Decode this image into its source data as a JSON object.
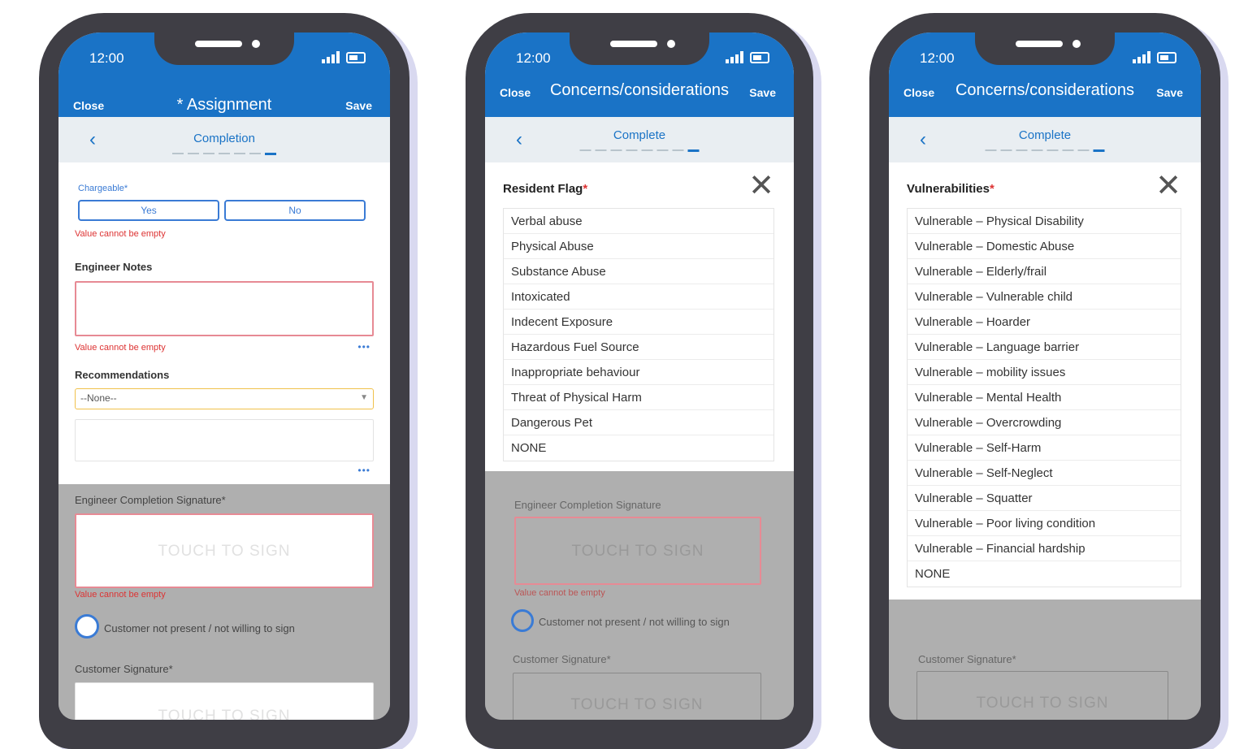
{
  "status": {
    "time": "12:00"
  },
  "phone1": {
    "close": "Close",
    "title": "* Assignment",
    "save": "Save",
    "step": "Completion",
    "chargeable_label": "Chargeable*",
    "yes": "Yes",
    "no": "No",
    "error": "Value cannot be empty",
    "engineer_notes": "Engineer Notes",
    "recommendations": "Recommendations",
    "recommendation_value": "--None--",
    "more": "•••",
    "engineer_signature": "Engineer Completion Signature*",
    "touch_to_sign": "TOUCH TO SIGN",
    "customer_not_present": "Customer not present / not willing to sign",
    "customer_signature": "Customer Signature*"
  },
  "phone2": {
    "close": "Close",
    "title": "Concerns/considerations",
    "save": "Save",
    "step": "Complete",
    "modal_title": "Resident Flag",
    "required_mark": "*",
    "items": [
      "Verbal abuse",
      "Physical Abuse",
      "Substance Abuse",
      "Intoxicated",
      "Indecent Exposure",
      "Hazardous Fuel Source",
      "Inappropriate behaviour",
      "Threat of Physical Harm",
      "Dangerous Pet",
      "NONE"
    ],
    "bg_signature": "Engineer Completion Signature",
    "touch_to_sign": "TOUCH TO SIGN",
    "error": "Value cannot be empty",
    "customer_not_present": "Customer not present / not willing to sign",
    "customer_signature": "Customer Signature*"
  },
  "phone3": {
    "close": "Close",
    "title": "Concerns/considerations",
    "save": "Save",
    "step": "Complete",
    "modal_title": "Vulnerabilities",
    "required_mark": "*",
    "items": [
      "Vulnerable – Physical Disability",
      "Vulnerable – Domestic Abuse",
      "Vulnerable – Elderly/frail",
      "Vulnerable – Vulnerable child",
      "Vulnerable – Hoarder",
      "Vulnerable – Language barrier",
      "Vulnerable – mobility issues",
      "Vulnerable – Mental Health",
      "Vulnerable – Overcrowding",
      "Vulnerable – Self-Harm",
      "Vulnerable – Self-Neglect",
      "Vulnerable – Squatter",
      "Vulnerable – Poor living condition",
      "Vulnerable – Financial hardship",
      "NONE"
    ],
    "customer_signature": "Customer Signature*",
    "touch_to_sign": "TOUCH TO SIGN"
  },
  "colors": {
    "primary": "#1a73c6",
    "error": "#dd3333",
    "frame": "#3f3e45"
  }
}
